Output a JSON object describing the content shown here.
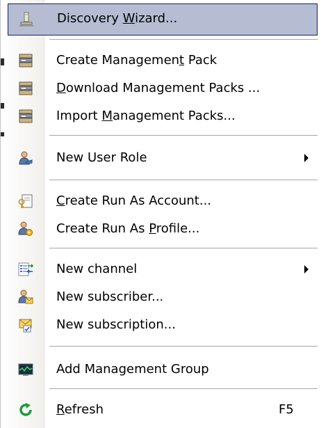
{
  "menu": {
    "items": [
      {
        "key": "discovery",
        "before": "Discovery ",
        "underline": "W",
        "after": "izard...",
        "icon": "discovery-wizard-icon",
        "highlighted": true
      },
      {
        "key": "create-mp",
        "before": "Create Managemen",
        "underline": "t",
        "after": " Pack",
        "icon": "management-pack-icon"
      },
      {
        "key": "download-mp",
        "before": "",
        "underline": "D",
        "after": "ownload Management Packs ...",
        "icon": "management-pack-icon"
      },
      {
        "key": "import-mp",
        "before": "Import ",
        "underline": "M",
        "after": "anagement Packs...",
        "icon": "management-pack-icon"
      },
      {
        "key": "new-user-role",
        "before": "New User Role",
        "underline": "",
        "after": "",
        "icon": "user-role-icon",
        "submenu": true
      },
      {
        "key": "run-as-account",
        "before": "",
        "underline": "C",
        "after": "reate Run As Account...",
        "icon": "run-as-account-icon"
      },
      {
        "key": "run-as-profile",
        "before": "Create Run As ",
        "underline": "P",
        "after": "rofile...",
        "icon": "run-as-profile-icon"
      },
      {
        "key": "new-channel",
        "before": "New channel",
        "underline": "",
        "after": "",
        "icon": "channel-icon",
        "submenu": true
      },
      {
        "key": "new-subscriber",
        "before": "New subscriber...",
        "underline": "",
        "after": "",
        "icon": "subscriber-icon"
      },
      {
        "key": "new-subscription",
        "before": "New subscription...",
        "underline": "",
        "after": "",
        "icon": "subscription-icon"
      },
      {
        "key": "add-mg",
        "before": "Add Management Group",
        "underline": "",
        "after": "",
        "icon": "management-group-icon"
      },
      {
        "key": "refresh",
        "before": "",
        "underline": "R",
        "after": "efresh",
        "icon": "refresh-icon",
        "shortcut": "F5"
      }
    ]
  },
  "colors": {
    "highlight_bg": "#b6bdd2",
    "highlight_border": "#0a246a",
    "separator": "#a6a6a6"
  }
}
